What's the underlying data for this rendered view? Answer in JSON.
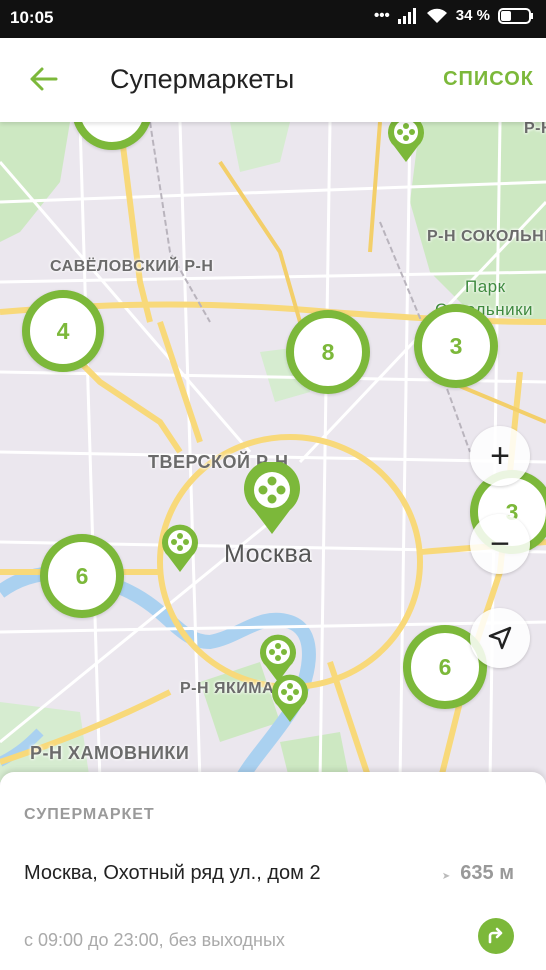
{
  "status_bar": {
    "time": "10:05",
    "battery": "34 %"
  },
  "app_bar": {
    "title": "Супермаркеты",
    "list_action": "СПИСОК"
  },
  "map": {
    "labels": {
      "savelovsky": "САВЁЛОВСКИЙ Р-Н",
      "sokolniki": "Р-Н СОКОЛЬНИ",
      "park_line1": "Парк",
      "park_line2": "Сокольники",
      "tverskoy": "ТВЕРСКОЙ Р-Н",
      "moscow": "Москва",
      "yakimanka": "Р-Н ЯКИМА",
      "khamovniki": "Р-Н ХАМОВНИКИ",
      "top_right": "Р-Н"
    },
    "clusters": {
      "c1": "4",
      "c2": "8",
      "c3": "3",
      "c4": "3",
      "c5": "6",
      "c6": "6"
    },
    "controls": {
      "zoom_in": "+",
      "zoom_out": "−"
    }
  },
  "store": {
    "category": "СУПЕРМАРКЕТ",
    "address": "Москва, Охотный ряд ул., дом 2",
    "distance": "635 м",
    "hours": "с 09:00 до 23:00, без выходных"
  },
  "colors": {
    "accent": "#7cb83a",
    "road": "#f8d97a",
    "park": "#cde8c2",
    "water": "#aad1f0"
  }
}
